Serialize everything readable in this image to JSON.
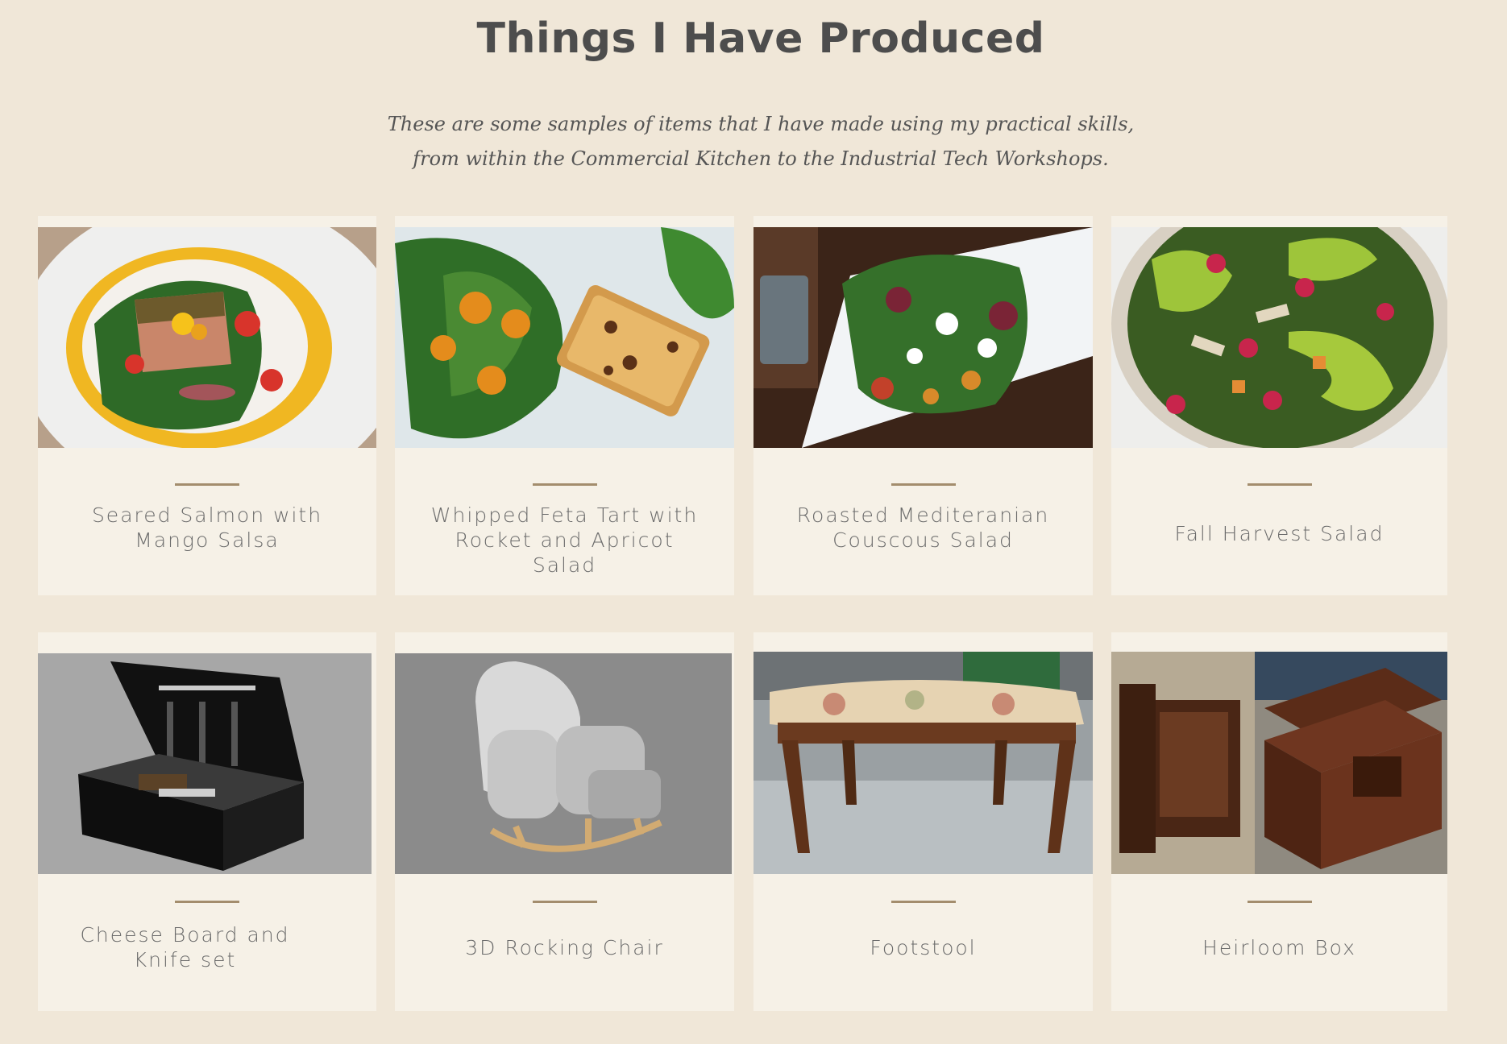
{
  "header": {
    "title": "Things I Have Produced",
    "intro_line_1": "These are some samples of items that I have made using my practical skills,",
    "intro_line_2": "from within the Commercial Kitchen to the Industrial Tech Workshops."
  },
  "gallery": {
    "items": [
      {
        "label": "Seared Salmon with Mango Salsa"
      },
      {
        "label": "Whipped Feta Tart with Rocket and Apricot Salad"
      },
      {
        "label": "Roasted Mediteranian Couscous Salad"
      },
      {
        "label": "Fall Harvest Salad"
      },
      {
        "label": "Cheese Board and Knife set"
      },
      {
        "label": "3D Rocking Chair"
      },
      {
        "label": "Footstool"
      },
      {
        "label": "Heirloom Box"
      }
    ]
  }
}
